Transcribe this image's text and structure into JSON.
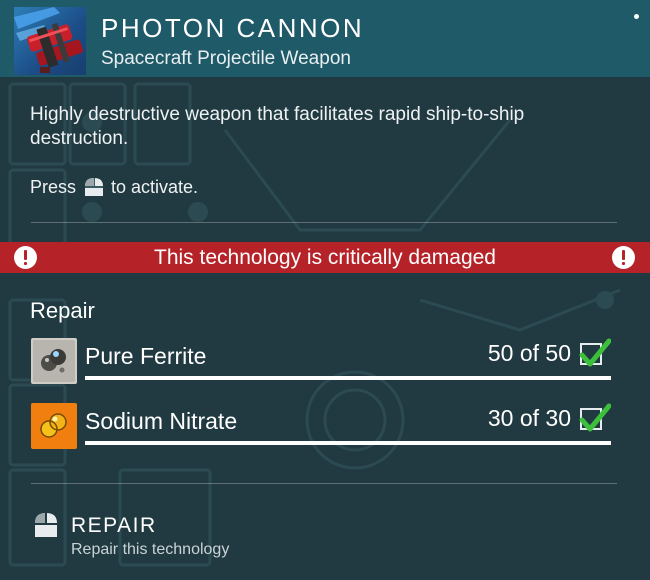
{
  "item": {
    "name": "PHOTON CANNON",
    "type": "Spacecraft Projectile Weapon",
    "icon": "photon-cannon-icon",
    "description": "Highly destructive weapon that facilitates rapid ship-to-ship destruction.",
    "activate_prefix": "Press",
    "activate_key_icon": "mouse-button-icon",
    "activate_suffix": "to activate."
  },
  "warning": {
    "text": "This technology is critically damaged",
    "color": "#b52228"
  },
  "repair": {
    "heading": "Repair",
    "materials": [
      {
        "name": "Pure Ferrite",
        "amount": "50 of 50",
        "icon": "pure-ferrite-icon",
        "progress": 1.0,
        "fulfilled": true
      },
      {
        "name": "Sodium Nitrate",
        "amount": "30 of 30",
        "icon": "sodium-nitrate-icon",
        "progress": 1.0,
        "fulfilled": true
      }
    ]
  },
  "action": {
    "label": "REPAIR",
    "description": "Repair this technology",
    "icon": "mouse-button-icon"
  },
  "colors": {
    "panel_bg": "#213a41",
    "header_bg": "#1f5a68",
    "check_green": "#3cc03c",
    "sodium_orange": "#f07f10"
  }
}
